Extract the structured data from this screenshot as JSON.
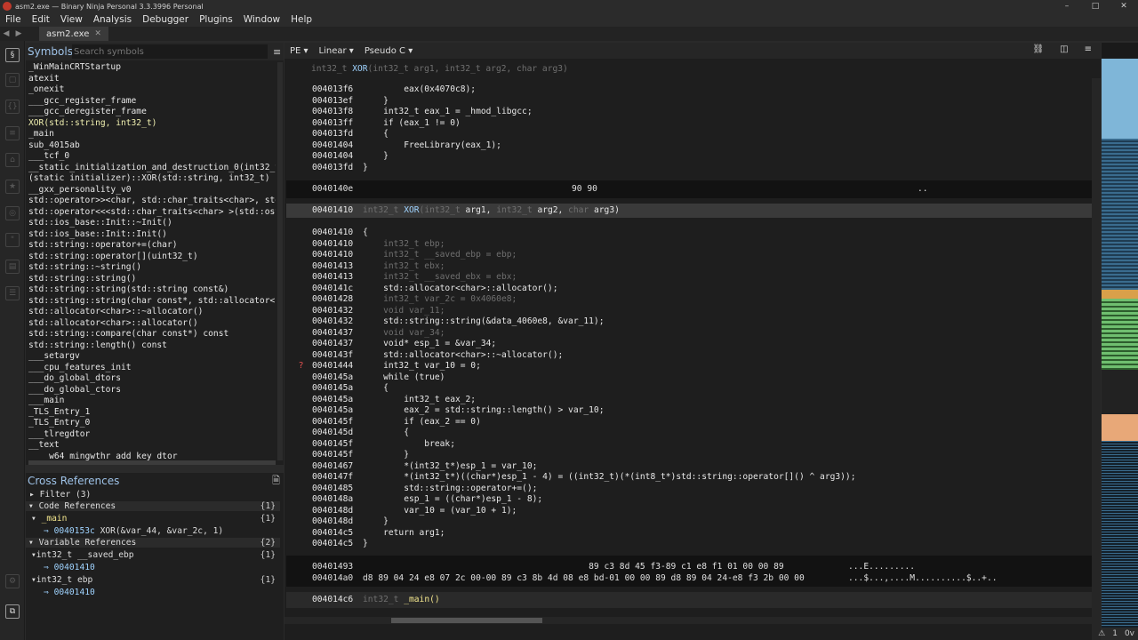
{
  "window": {
    "title": "asm2.exe — Binary Ninja Personal 3.3.3996 Personal",
    "min": "–",
    "max": "□",
    "close": "✕"
  },
  "menu": [
    "File",
    "Edit",
    "View",
    "Analysis",
    "Debugger",
    "Plugins",
    "Window",
    "Help"
  ],
  "tab": {
    "label": "asm2.exe",
    "close": "✕"
  },
  "symbols": {
    "title": "Symbols",
    "search_placeholder": "Search symbols",
    "items": [
      "_WinMainCRTStartup",
      "atexit",
      "_onexit",
      "___gcc_register_frame",
      "___gcc_deregister_frame",
      "XOR(std::string, int32_t)",
      "_main",
      "sub_4015ab",
      "___tcf_0",
      "__static_initialization_and_destruction_0(int32_t",
      "(static initializer)::XOR(std::string, int32_t)",
      "__gxx_personality_v0",
      "std::operator>><char, std::char_traits<char>, std",
      "std::operator<<<std::char_traits<char> >(std::ost",
      "std::ios_base::Init::~Init()",
      "std::ios_base::Init::Init()",
      "std::string::operator+=(char)",
      "std::string::operator[](uint32_t)",
      "std::string::~string()",
      "std::string::string()",
      "std::string::string(std::string const&)",
      "std::string::string(char const*, std::allocator<c",
      "std::allocator<char>::~allocator()",
      "std::allocator<char>::allocator()",
      "std::string::compare(char const*) const",
      "std::string::length() const",
      "___setargv",
      "___cpu_features_init",
      "___do_global_dtors",
      "___do_global_ctors",
      "___main",
      "_TLS_Entry_1",
      "_TLS_Entry_0",
      "___tlregdtor",
      "__text",
      "____w64_mingwthr_add_key_dtor"
    ]
  },
  "xrefs": {
    "title": "Cross References",
    "filter": "Filter (3)",
    "code_refs": {
      "label": "Code References",
      "count": "{1}"
    },
    "main": {
      "label": "_main",
      "count": "{1}"
    },
    "main_ref": {
      "addr": "0040153c",
      "text": "XOR(&var_44, &var_2c, 1)"
    },
    "var_refs": {
      "label": "Variable References",
      "count": "{2}"
    },
    "saved_ebp": {
      "label": "int32_t __saved_ebp",
      "count": "{1}"
    },
    "saved_ebp_ref": "00401410",
    "ebp": {
      "label": "int32_t ebp",
      "count": "{1}"
    },
    "ebp_ref": "00401410"
  },
  "viewbar": {
    "pe": "PE ▾",
    "linear": "Linear ▾",
    "pseudo": "Pseudo C ▾"
  },
  "func_header": {
    "ret": "int32_t",
    "name": "XOR",
    "args": "(int32_t arg1, int32_t arg2, char arg3)"
  },
  "code_top": [
    {
      "a": "004013f6",
      "c": "        eax(0x4070c8);"
    },
    {
      "a": "004013ef",
      "c": "    }"
    },
    {
      "a": "004013f8",
      "c": "    int32_t eax_1 = _hmod_libgcc;"
    },
    {
      "a": "004013ff",
      "c": "    if (eax_1 != 0)"
    },
    {
      "a": "004013fd",
      "c": "    {"
    },
    {
      "a": "00401404",
      "c": "        FreeLibrary(eax_1);"
    },
    {
      "a": "00401404",
      "c": "    }"
    },
    {
      "a": "004013fd",
      "c": "}"
    }
  ],
  "pad_row": {
    "addr": "0040140e",
    "bytes": "90 90",
    "ascii": ".."
  },
  "func2_header": {
    "addr": "00401410",
    "ret": "int32_t",
    "name": "XOR",
    "p1t": "(int32_t",
    "p1": "arg1,",
    "p2t": "int32_t",
    "p2": "arg2,",
    "p3t": "char",
    "p3": "arg3)"
  },
  "code_body": [
    {
      "a": "00401410",
      "c": "{",
      "d": false
    },
    {
      "a": "00401410",
      "c": "    int32_t ebp;",
      "d": true
    },
    {
      "a": "00401410",
      "c": "    int32_t __saved_ebp = ebp;",
      "d": true
    },
    {
      "a": "00401413",
      "c": "    int32_t ebx;",
      "d": true
    },
    {
      "a": "00401413",
      "c": "    int32_t __saved_ebx = ebx;",
      "d": true
    },
    {
      "a": "0040141c",
      "c": "    std::allocator<char>::allocator();",
      "d": false
    },
    {
      "a": "00401428",
      "c": "    int32_t var_2c = 0x4060e8;",
      "d": true
    },
    {
      "a": "00401432",
      "c": "    void var_11;",
      "d": true
    },
    {
      "a": "00401432",
      "c": "    std::string::string(&data_4060e8, &var_11);",
      "d": false
    },
    {
      "a": "00401437",
      "c": "    void var_34;",
      "d": true
    },
    {
      "a": "00401437",
      "c": "    void* esp_1 = &var_34;",
      "d": false
    },
    {
      "a": "0040143f",
      "c": "    std::allocator<char>::~allocator();",
      "d": false
    },
    {
      "a": "00401444",
      "c": "    int32_t var_10 = 0;",
      "d": false
    },
    {
      "a": "0040145a",
      "c": "    while (true)",
      "d": false
    },
    {
      "a": "0040145a",
      "c": "    {",
      "d": false
    },
    {
      "a": "0040145a",
      "c": "        int32_t eax_2;",
      "d": false
    },
    {
      "a": "0040145a",
      "c": "        eax_2 = std::string::length() > var_10;",
      "d": false
    },
    {
      "a": "0040145f",
      "c": "        if (eax_2 == 0)",
      "d": false
    },
    {
      "a": "0040145d",
      "c": "        {",
      "d": false
    },
    {
      "a": "0040145f",
      "c": "            break;",
      "d": false
    },
    {
      "a": "0040145f",
      "c": "        }",
      "d": false
    },
    {
      "a": "00401467",
      "c": "        *(int32_t*)esp_1 = var_10;",
      "d": false
    },
    {
      "a": "0040147f",
      "c": "        *(int32_t*)((char*)esp_1 - 4) = ((int32_t)(*(int8_t*)std::string::operator[]() ^ arg3));",
      "d": false
    },
    {
      "a": "00401485",
      "c": "        std::string::operator+=();",
      "d": false
    },
    {
      "a": "0040148a",
      "c": "        esp_1 = ((char*)esp_1 - 8);",
      "d": false
    },
    {
      "a": "0040148d",
      "c": "        var_10 = (var_10 + 1);",
      "d": false
    },
    {
      "a": "0040148d",
      "c": "    }",
      "d": false
    },
    {
      "a": "004014c5",
      "c": "    return arg1;",
      "d": false
    },
    {
      "a": "004014c5",
      "c": "}",
      "d": false
    }
  ],
  "hex_rows": [
    {
      "a": "00401493",
      "b": "                                            89 c3 8d 45 f3-89 c1 e8 f1 01 00 00 89",
      "s": "...E........."
    },
    {
      "a": "004014a0",
      "b": "d8 89 04 24 e8 07 2c 00-00 89 c3 8b 4d 08 e8 bd-01 00 00 89 d8 89 04 24-e8 f3 2b 00 00",
      "s": "...$...,....M..........$..+.."
    }
  ],
  "func3_header": {
    "addr": "004014c6",
    "ret": "int32_t",
    "name": "_main()"
  },
  "status": {
    "warn": "1",
    "ver": "0v"
  }
}
